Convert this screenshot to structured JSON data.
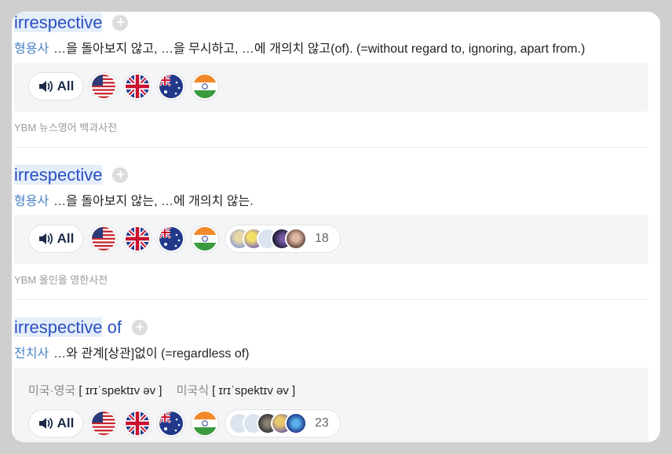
{
  "entries": [
    {
      "word_main": "irrespective",
      "word_extra": "",
      "pos": "형용사",
      "definition": "…을 돌아보지 않고, …을 무시하고, …에 개의치 않고(of). (=without regard to, ignoring, apart from.)",
      "all_label": "All",
      "voice_count": "",
      "source": "YBM 뉴스영어 백과사전"
    },
    {
      "word_main": "irrespective",
      "word_extra": "",
      "pos": "형용사",
      "definition": "…을 돌아보지 않는, …에 개의치 않는.",
      "all_label": "All",
      "voice_count": "18",
      "source": "YBM 올인올 영한사전"
    },
    {
      "word_main": "irrespective",
      "word_extra": " of",
      "pos": "전치사",
      "definition": "…와 관계[상관]없이 (=regardless of)",
      "pron_label_1": "미국·영국",
      "pron_ipa_1": "[ ɪrɪˈspektɪv əv ]",
      "pron_label_2": "미국식",
      "pron_ipa_2": "[ ɪrɪˈspektɪv əv ]",
      "all_label": "All",
      "voice_count": "23",
      "source": ""
    }
  ],
  "plus_symbol": "+",
  "flags": [
    "us-flag-icon",
    "uk-flag-icon",
    "australia-flag-icon",
    "india-flag-icon"
  ],
  "colors": {
    "word": "#2b4fbf",
    "pos": "#4a82c6",
    "box": "#f4f5f6",
    "source": "#9a9a9a"
  }
}
